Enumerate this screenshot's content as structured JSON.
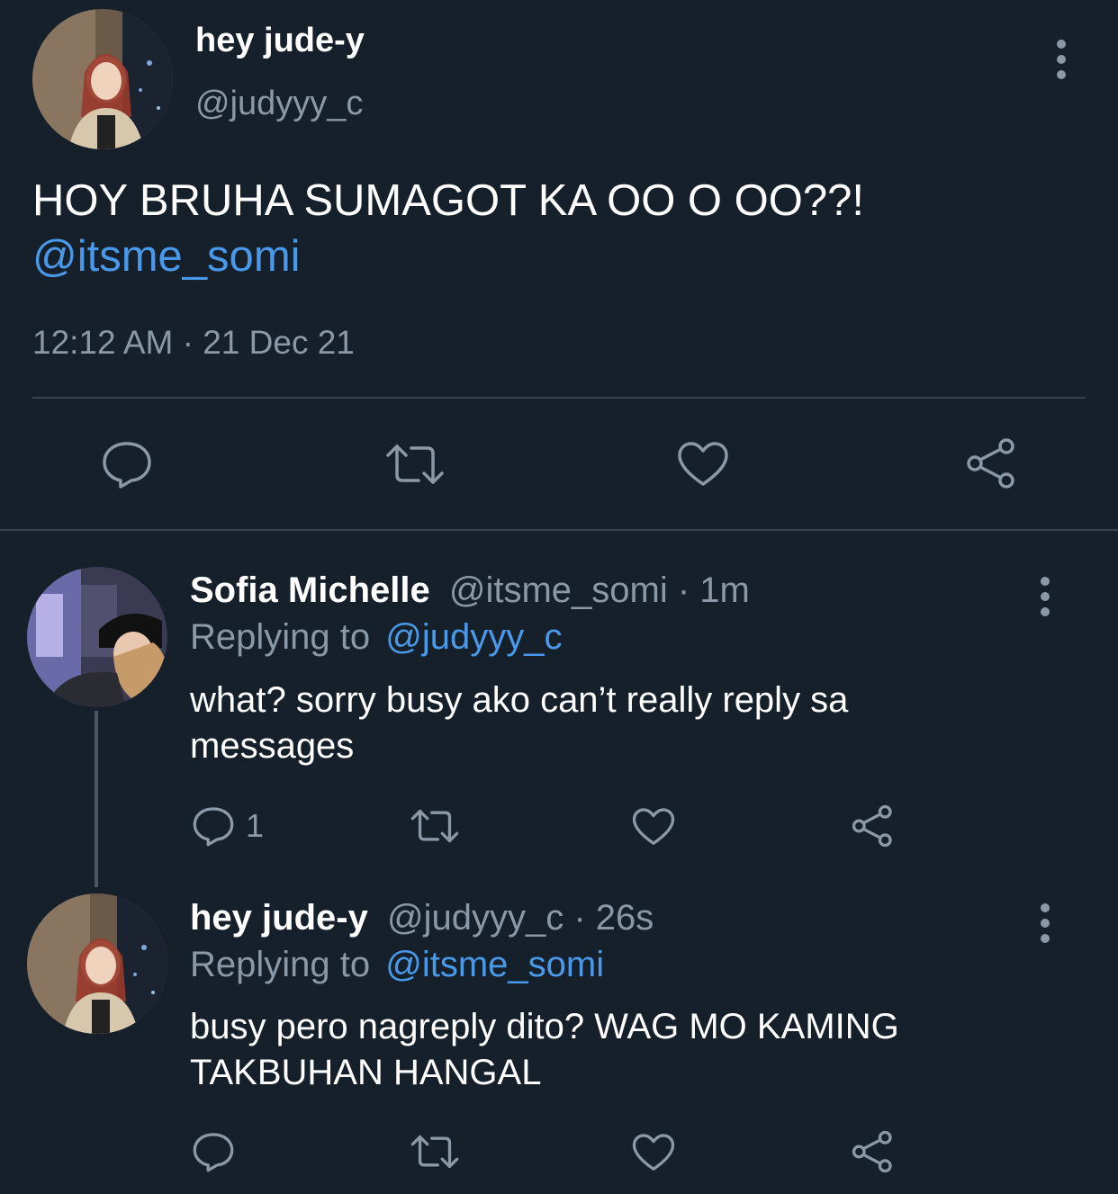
{
  "main_tweet": {
    "display_name": "hey jude-y",
    "handle": "@judyyy_c",
    "text": "HOY BRUHA SUMAGOT KA OO O OO??!",
    "mention": "@itsme_somi",
    "timestamp": "12:12 AM · 21 Dec 21",
    "actions": [
      "reply-icon",
      "retweet-icon",
      "like-icon",
      "share-icon"
    ]
  },
  "replies": [
    {
      "display_name": "Sofia Michelle",
      "handle": "@itsme_somi",
      "time": "· 1m",
      "replying_label": "Replying to",
      "replying_to": "@judyyy_c",
      "text_line1": "what? sorry busy ako can’t really reply sa",
      "text_line2": "messages",
      "reply_count": "1"
    },
    {
      "display_name": "hey jude-y",
      "handle": "@judyyy_c",
      "time": "· 26s",
      "replying_label": "Replying to",
      "replying_to": "@itsme_somi",
      "text_line1": "busy pero nagreply dito? WAG MO KAMING",
      "text_line2": "TAKBUHAN HANGAL",
      "reply_count": ""
    }
  ],
  "colors": {
    "background": "#15202b",
    "text": "#ffffff",
    "muted": "#8b98a5",
    "link": "#4a99e9",
    "divider": "#38444d"
  }
}
